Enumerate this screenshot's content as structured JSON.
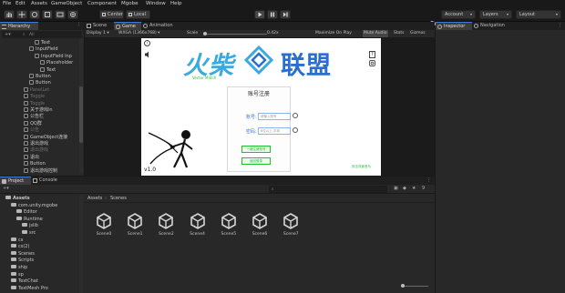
{
  "menu": [
    "File",
    "Edit",
    "Assets",
    "GameObject",
    "Component",
    "Mgobe",
    "Window",
    "Help"
  ],
  "toolbar": {
    "tools": [
      "hand-tool",
      "move-tool",
      "rotate-tool",
      "scale-tool",
      "rect-tool",
      "transform-tool"
    ],
    "center_label": "Center",
    "local_label": "Local",
    "account_label": "Account",
    "layers_label": "Layers",
    "layout_label": "Layout"
  },
  "hierarchy": {
    "tab": "Hierarchy",
    "search_placeholder": "All",
    "rows": [
      {
        "label": "Text",
        "indent": 38,
        "kind": "go",
        "dim": false
      },
      {
        "label": "InputField",
        "indent": 32,
        "kind": "go",
        "dim": false
      },
      {
        "label": "InputField Inp",
        "indent": 38,
        "kind": "go",
        "dim": false
      },
      {
        "label": "Placeholder",
        "indent": 44,
        "kind": "go",
        "dim": false
      },
      {
        "label": "Text",
        "indent": 44,
        "kind": "go",
        "dim": false
      },
      {
        "label": "Button",
        "indent": 32,
        "kind": "go",
        "dim": false
      },
      {
        "label": "Button",
        "indent": 32,
        "kind": "go",
        "dim": false
      },
      {
        "label": "PanelLet",
        "indent": 26,
        "kind": "go",
        "dim": true
      },
      {
        "label": "Toggle",
        "indent": 26,
        "kind": "go",
        "dim": true
      },
      {
        "label": "Toggle",
        "indent": 26,
        "kind": "go",
        "dim": true
      },
      {
        "label": "关于游戏in",
        "indent": 26,
        "kind": "go",
        "dim": false
      },
      {
        "label": "公告栏",
        "indent": 26,
        "kind": "go",
        "dim": false
      },
      {
        "label": "QQ群",
        "indent": 26,
        "kind": "go",
        "dim": false
      },
      {
        "label": "公告",
        "indent": 26,
        "kind": "go",
        "dim": true
      },
      {
        "label": "GameObject连接",
        "indent": 26,
        "kind": "go",
        "dim": false
      },
      {
        "label": "退出游戏",
        "indent": 26,
        "kind": "go",
        "dim": false
      },
      {
        "label": "退出游戏",
        "indent": 26,
        "kind": "go",
        "dim": true
      },
      {
        "label": "退出",
        "indent": 26,
        "kind": "go",
        "dim": false
      },
      {
        "label": "Button",
        "indent": 26,
        "kind": "go",
        "dim": false
      },
      {
        "label": "退出游戏控制",
        "indent": 26,
        "kind": "go",
        "dim": false
      }
    ]
  },
  "game": {
    "tabs": [
      "Scene",
      "Game",
      "Animation"
    ],
    "display": "Display 1",
    "resolution": "WXGA (1366x768)",
    "scale_label": "Scale",
    "scale_value": "0.42x",
    "toggles": [
      "Maximize On Play",
      "Mute Audio",
      "Stats",
      "Gizmos"
    ],
    "screen": {
      "logo_left": "火柴",
      "logo_right": "联盟",
      "logo_sub": "Vector Match",
      "title": "账号注册",
      "account_label": "账号:",
      "account_value": "请输入账号",
      "password_label": "密码:",
      "password_value": "6位以上,字母",
      "register_btn": "一键注册账号",
      "login_btn": "返回登录",
      "version": "v1.0",
      "corner_note": "双击背景音乐",
      "help_mark": "?"
    }
  },
  "inspector": {
    "tabs": [
      "Inspector",
      "Navigation"
    ]
  },
  "project": {
    "tabs": [
      "Project",
      "Console"
    ],
    "search_placeholder": "",
    "count": "9",
    "tree": [
      {
        "label": "Assets",
        "indent": 6,
        "bold": true
      },
      {
        "label": "com.unity.mgobe",
        "indent": 12,
        "bold": false
      },
      {
        "label": "Editor",
        "indent": 18,
        "bold": false
      },
      {
        "label": "Runtime",
        "indent": 18,
        "bold": false
      },
      {
        "label": "jslib",
        "indent": 24,
        "bold": false
      },
      {
        "label": "src",
        "indent": 24,
        "bold": false
      },
      {
        "label": "cs",
        "indent": 12,
        "bold": false
      },
      {
        "label": "cs(2)",
        "indent": 12,
        "bold": false
      },
      {
        "label": "Scenes",
        "indent": 12,
        "bold": false
      },
      {
        "label": "Scripts",
        "indent": 12,
        "bold": false
      },
      {
        "label": "ship",
        "indent": 12,
        "bold": false
      },
      {
        "label": "sp",
        "indent": 12,
        "bold": false
      },
      {
        "label": "TextChat",
        "indent": 12,
        "bold": false
      },
      {
        "label": "TextMesh Pro",
        "indent": 12,
        "bold": false
      }
    ],
    "breadcrumb": [
      "Assets",
      "Scenes"
    ],
    "assets": [
      "Scene0",
      "Scene1",
      "Scene2",
      "Scene4",
      "Scene5",
      "Scene6",
      "Scene7"
    ]
  },
  "colors": {
    "accent": "#3d7bd6",
    "logo_cyan": "#3aa9e0",
    "logo_blue": "#2a6fd0",
    "screen_green": "#1fc12f",
    "input_border": "#8db4e8"
  }
}
